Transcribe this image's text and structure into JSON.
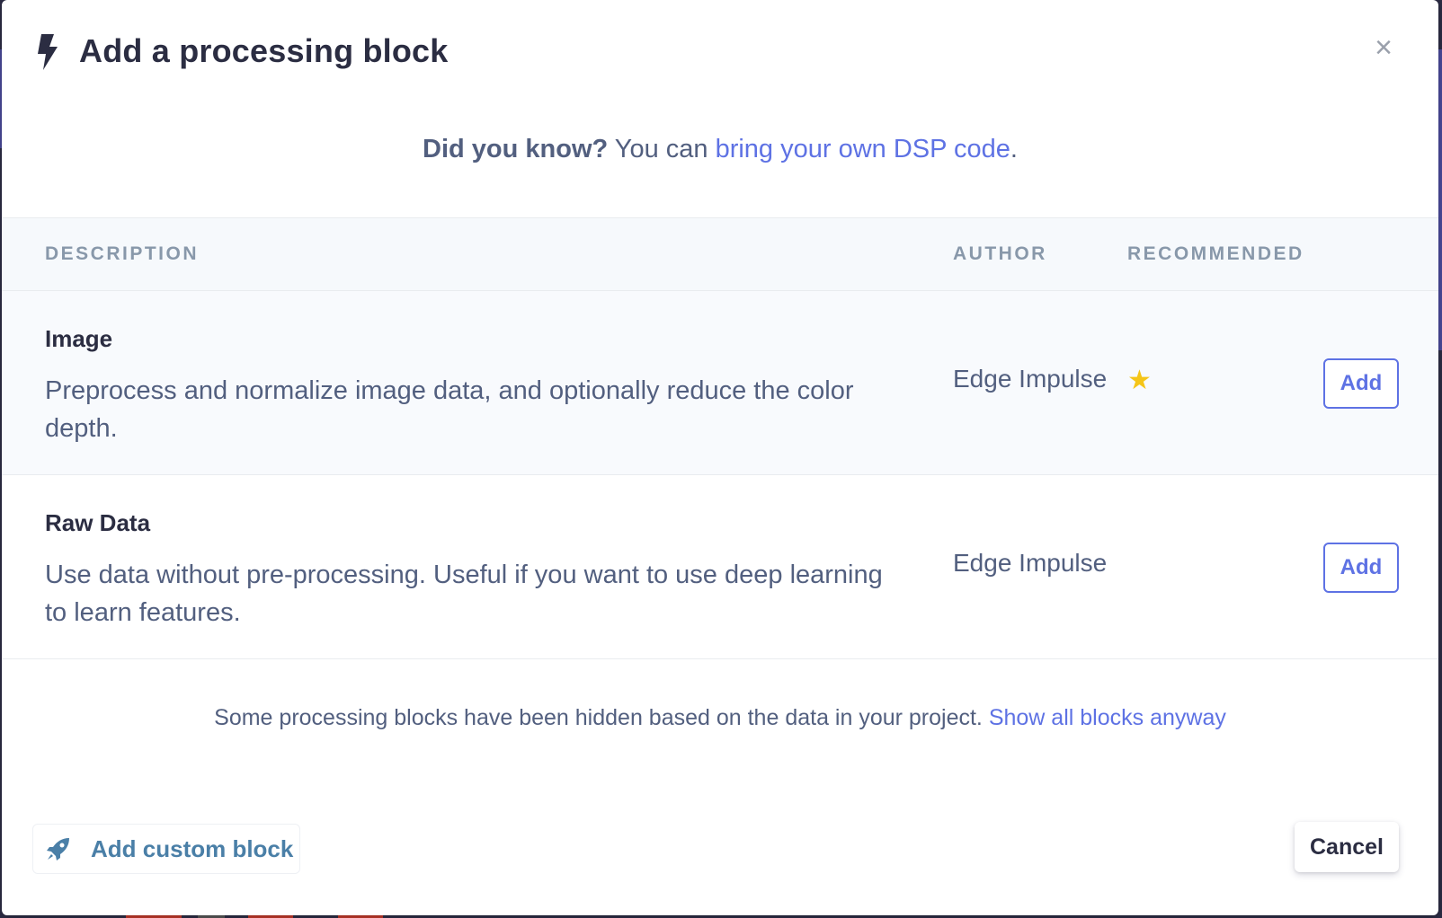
{
  "modal": {
    "title": "Add a processing block",
    "close_glyph": "×"
  },
  "tip": {
    "bold": "Did you know?",
    "text": " You can ",
    "link": "bring your own DSP code",
    "end": "."
  },
  "table": {
    "headers": {
      "description": "DESCRIPTION",
      "author": "AUTHOR",
      "recommended": "RECOMMENDED"
    },
    "rows": [
      {
        "name": "Image",
        "description": "Preprocess and normalize image data, and optionally reduce the color depth.",
        "author": "Edge Impulse",
        "recommended": true,
        "recommended_glyph": "★",
        "action": "Add"
      },
      {
        "name": "Raw Data",
        "description": "Use data without pre-processing. Useful if you want to use deep learning to learn features.",
        "author": "Edge Impulse",
        "recommended": false,
        "action": "Add"
      }
    ]
  },
  "hidden_note": {
    "text": "Some processing blocks have been hidden based on the data in your project. ",
    "link": "Show all blocks anyway"
  },
  "footer": {
    "custom_block_label": "Add custom block",
    "cancel_label": "Cancel"
  },
  "colors": {
    "accent": "#5e72e4",
    "title": "#2b2d42",
    "text": "#525f7f",
    "header_bg": "#f6f9fc",
    "star": "#f5c518"
  },
  "icons": {
    "title_icon": "bolt-icon",
    "close_icon": "close-icon",
    "star_icon": "star-icon",
    "custom_block_icon": "rocket-icon"
  }
}
